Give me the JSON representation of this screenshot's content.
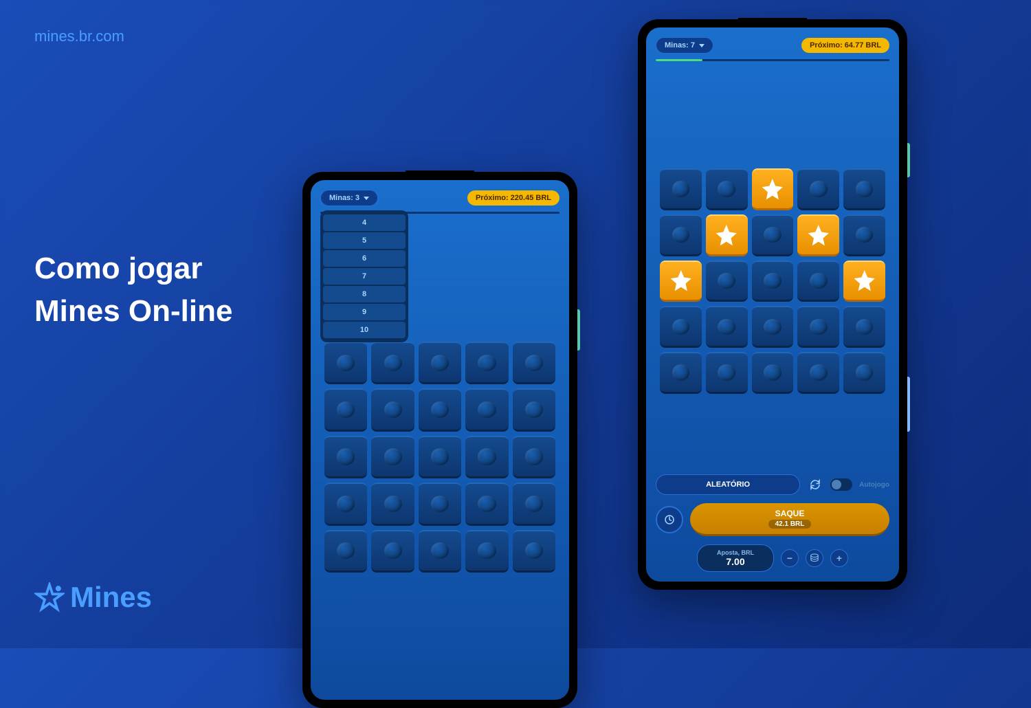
{
  "site_url": "mines.br.com",
  "hero": {
    "line1": "Como jogar",
    "line2": "Mines On-line"
  },
  "logo_text": "Mines",
  "phone_left": {
    "mines_label": "Minas: 3",
    "next_label": "Próximo: 220.45 BRL",
    "dropdown_options": [
      "4",
      "5",
      "6",
      "7",
      "8",
      "9",
      "10"
    ],
    "progress": 0
  },
  "phone_right": {
    "mines_label": "Minas: 7",
    "next_label": "Próximo: 64.77 BRL",
    "progress": 20,
    "grid_stars": [
      2,
      6,
      8,
      10,
      14
    ],
    "random_label": "ALEATÓRIO",
    "auto_label": "Autojogo",
    "saque_label": "SAQUE",
    "saque_amount": "42.1 BRL",
    "bet_label": "Aposta, BRL",
    "bet_value": "7.00"
  }
}
